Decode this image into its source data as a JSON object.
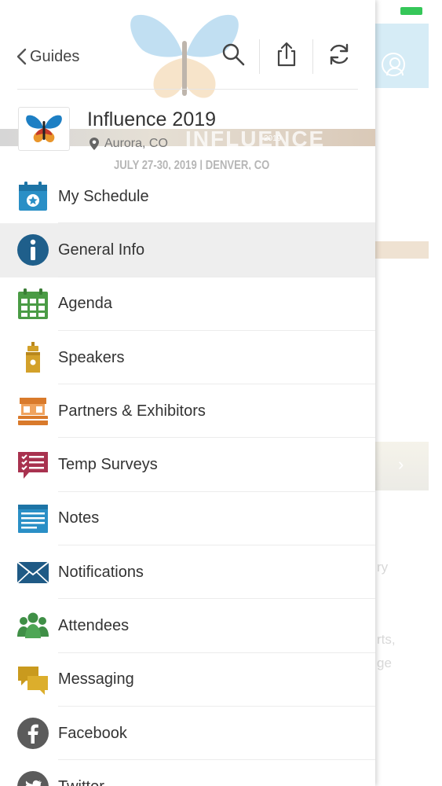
{
  "colors": {
    "calendar": "#2a8fc6",
    "info": "#1f5f8b",
    "agenda": "#4a9b45",
    "speakers": "#d3a12a",
    "partners": "#d97a2b",
    "surveys": "#a8324f",
    "notes": "#2a8fc6",
    "notifications": "#1f5a85",
    "attendees": "#3f8f46",
    "messaging": "#c99a1e",
    "social": "#5b5b5b"
  },
  "header": {
    "back_label": "Guides",
    "icons": [
      "search-icon",
      "share-icon",
      "refresh-icon"
    ]
  },
  "event": {
    "title": "Influence 2019",
    "location": "Aurora, CO",
    "banner_watermark": "INFLUENCE",
    "banner_year": "2019",
    "banner_dates": "JULY 27-30, 2019 | DENVER, CO"
  },
  "menu": [
    {
      "label": "My Schedule",
      "icon": "calendar-star-icon"
    },
    {
      "label": "General Info",
      "icon": "info-icon",
      "active": true
    },
    {
      "label": "Agenda",
      "icon": "calendar-grid-icon"
    },
    {
      "label": "Speakers",
      "icon": "podium-icon"
    },
    {
      "label": "Partners & Exhibitors",
      "icon": "booth-icon"
    },
    {
      "label": "Temp Surveys",
      "icon": "survey-icon"
    },
    {
      "label": "Notes",
      "icon": "notes-icon"
    },
    {
      "label": "Notifications",
      "icon": "envelope-icon"
    },
    {
      "label": "Attendees",
      "icon": "people-icon"
    },
    {
      "label": "Messaging",
      "icon": "chat-bubbles-icon"
    },
    {
      "label": "Facebook",
      "icon": "facebook-icon"
    },
    {
      "label": "Twitter",
      "icon": "twitter-icon"
    }
  ],
  "background": {
    "text_fragments": [
      "ry",
      "rts,",
      "ge"
    ]
  }
}
